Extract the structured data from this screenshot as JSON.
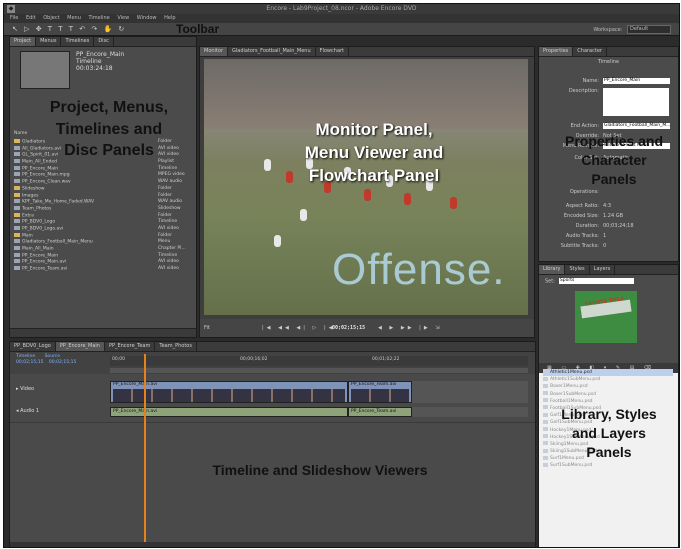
{
  "app": {
    "title": "Encore - Lab9Project_08.ncor - Adobe Encore DVD",
    "menu": [
      "File",
      "Edit",
      "Object",
      "Menu",
      "Timeline",
      "View",
      "Window",
      "Help"
    ],
    "workspace_label": "Workspace:",
    "workspace_value": "Default"
  },
  "toolbar": {
    "tools": "↖ ▷ ✥ T T T ↶ ↷ ✋ ↻",
    "annotation": "Toolbar"
  },
  "project_panel": {
    "tabs": [
      "Project",
      "Menus",
      "Timelines",
      "Disc"
    ],
    "asset_name": "PP_Encore_Main",
    "asset_type": "Timeline",
    "asset_duration": "00:03:24:18",
    "name_header": "Name",
    "items": [
      {
        "name": "Gladiators",
        "type": "Folder",
        "folder": true
      },
      {
        "name": "All_Gladiators.avi",
        "type": "AVI video",
        "folder": false
      },
      {
        "name": "GL_Spirit_01.avi",
        "type": "AVI video",
        "folder": false
      },
      {
        "name": "Main_All_Ended",
        "type": "Playlist",
        "folder": false
      },
      {
        "name": "PP_Encore_Main",
        "type": "Timeline",
        "folder": false
      },
      {
        "name": "PP_Encore_Main.mpg",
        "type": "MPEG video",
        "folder": false
      },
      {
        "name": "PP_Encore_Clean.wav",
        "type": "WAV audio",
        "folder": false
      },
      {
        "name": "Slideshow",
        "type": "Folder",
        "folder": true
      },
      {
        "name": "Images",
        "type": "Folder",
        "folder": true
      },
      {
        "name": "KPF_Take_Me_Home_Faded.WAV",
        "type": "WAV audio",
        "folder": false
      },
      {
        "name": "Team_Photos",
        "type": "Slideshow",
        "folder": false
      },
      {
        "name": "Extra",
        "type": "Folder",
        "folder": true
      },
      {
        "name": "PP_BDV0_Logo",
        "type": "Timeline",
        "folder": false
      },
      {
        "name": "PP_BDV0_Logo.avi",
        "type": "AVI video",
        "folder": false
      },
      {
        "name": "Main",
        "type": "Folder",
        "folder": true
      },
      {
        "name": "Gladiators_Football_Main_Menu",
        "type": "Menu",
        "folder": false
      },
      {
        "name": "Main_All_Main",
        "type": "Chapter Pl...",
        "folder": false
      },
      {
        "name": "PP_Encore_Main",
        "type": "Timeline",
        "folder": false
      },
      {
        "name": "PP_Encore_Main.avi",
        "type": "AVI video",
        "folder": false
      },
      {
        "name": "PP_Encore_Team.avi",
        "type": "AVI video",
        "folder": false
      }
    ],
    "annotation_lines": [
      "Project, Menus,",
      "Timelines and",
      "Disc Panels"
    ]
  },
  "monitor_panel": {
    "tabs": [
      "Monitor",
      "Gladiators_Football_Main_Menu",
      "Flowchart"
    ],
    "timecode": "00;02;15;15",
    "overlay_text": "Offense.",
    "zoom": "Fit",
    "annotation_lines": [
      "Monitor Panel,",
      "Menu Viewer and",
      "Flowchart Panel"
    ]
  },
  "properties_panel": {
    "tabs": [
      "Properties",
      "Character"
    ],
    "section": "Timeline",
    "fields": [
      {
        "label": "Name:",
        "value": "PP_Encore_Main"
      },
      {
        "label": "Description:",
        "value": ""
      },
      {
        "label": "End Action:",
        "value": "Gladiators_Football_Main_M..."
      },
      {
        "label": "Override:",
        "value": "Not Set"
      },
      {
        "label": "Menu Remote:",
        "value": "Return to Last Menu"
      },
      {
        "label": "Color Set:",
        "value": "Automatic"
      }
    ],
    "info": [
      {
        "label": "Aspect Ratio:",
        "value": "4:3"
      },
      {
        "label": "Encoded Size:",
        "value": "1.24 GB"
      },
      {
        "label": "Duration:",
        "value": "00;03;24;18"
      },
      {
        "label": "Audio Tracks:",
        "value": "1"
      },
      {
        "label": "Subtitle Tracks:",
        "value": "0"
      }
    ],
    "operations_label": "Operations:",
    "annotation_lines": [
      "Properties and",
      "Character",
      "Panels"
    ]
  },
  "library_panel": {
    "tabs": [
      "Library",
      "Styles",
      "Layers"
    ],
    "set_label": "Set:",
    "set_value": "Sports",
    "preview_title": "SPORTS TITLE",
    "items": [
      "Athletic1Menu.psd",
      "Athletic1SubMenu.psd",
      "Boxer1Menu.psd",
      "Boxer1SubMenu.psd",
      "Football1Menu.psd",
      "Football1SubMenu.psd",
      "Golf1Menu.psd",
      "Golf1SubMenu.psd",
      "Hockey1Menu.psd",
      "Hockey1SubMenu.psd",
      "Skiing1Menu.psd",
      "Skiing1SubMenu.psd",
      "Surf1Menu.psd",
      "Surf1SubMenu.psd"
    ],
    "annotation_lines": [
      "Library, Styles",
      "and Layers",
      "Panels"
    ]
  },
  "timeline_panel": {
    "tabs": [
      "PP_BDV0_Logo",
      "PP_Encore_Main",
      "PP_Encore_Team",
      "Team_Photos"
    ],
    "tc_timeline_label": "Timeline",
    "tc_timeline": "00;02;15;15",
    "tc_source_label": "Source",
    "tc_source": "00;02;15;15",
    "ruler_ticks": [
      "00;00",
      "00;00;16;02",
      "00;01;02;22"
    ],
    "video_label": "Video",
    "audio_label": "Audio 1",
    "clips": [
      {
        "name": "PP_Encore_Main.avi"
      },
      {
        "name": "PP_Encore_Team.avi"
      }
    ],
    "audio_clips": [
      {
        "name": "PP_Encore_Main.avi"
      },
      {
        "name": "PP_Encore_Team.avi"
      }
    ],
    "annotation": "Timeline and Slideshow Viewers"
  }
}
